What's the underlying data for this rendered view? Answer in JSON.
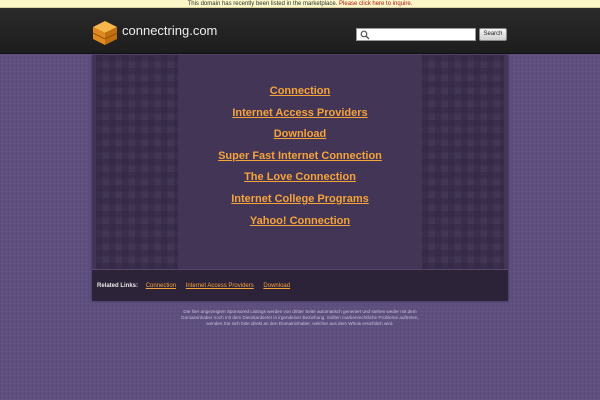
{
  "notice": {
    "text": "This domain has recently been listed in the marketplace.",
    "link": "Please click here to inquire."
  },
  "header": {
    "logo_icon": "cube-logo-icon",
    "site_name": "connectring.com",
    "search": {
      "placeholder": "",
      "value": "",
      "icon": "search-icon",
      "button_label": "Search"
    }
  },
  "main": {
    "links": [
      {
        "label": "Connection"
      },
      {
        "label": "Internet Access Providers"
      },
      {
        "label": "Download"
      },
      {
        "label": "Super Fast Internet Connection"
      },
      {
        "label": "The Love Connection"
      },
      {
        "label": "Internet College Programs"
      },
      {
        "label": "Yahoo! Connection"
      }
    ]
  },
  "related": {
    "label": "Related Links:",
    "links": [
      {
        "label": "Connection"
      },
      {
        "label": "Internet Access Providers"
      },
      {
        "label": "Download"
      }
    ]
  },
  "disclaimer": {
    "line1": "Die hier angezeigten Sponsored Listings werden von dritter Seite automatisch generiert und stehen weder mit dem",
    "line2": "Domaininhaber noch mit dem Dienstanbieter in irgendeiner Beziehung. Sollten markenrechtliche Probleme auftreten,",
    "line3": "wenden Sie sich bitte direkt an den Domaininhaber, welcher aus dem Whois ersichtlich wird."
  },
  "colors": {
    "background": "#5e4f7f",
    "panel": "#423555",
    "link": "#f5a33b",
    "header": "#1d1d1d",
    "notice_link": "#b01818"
  }
}
